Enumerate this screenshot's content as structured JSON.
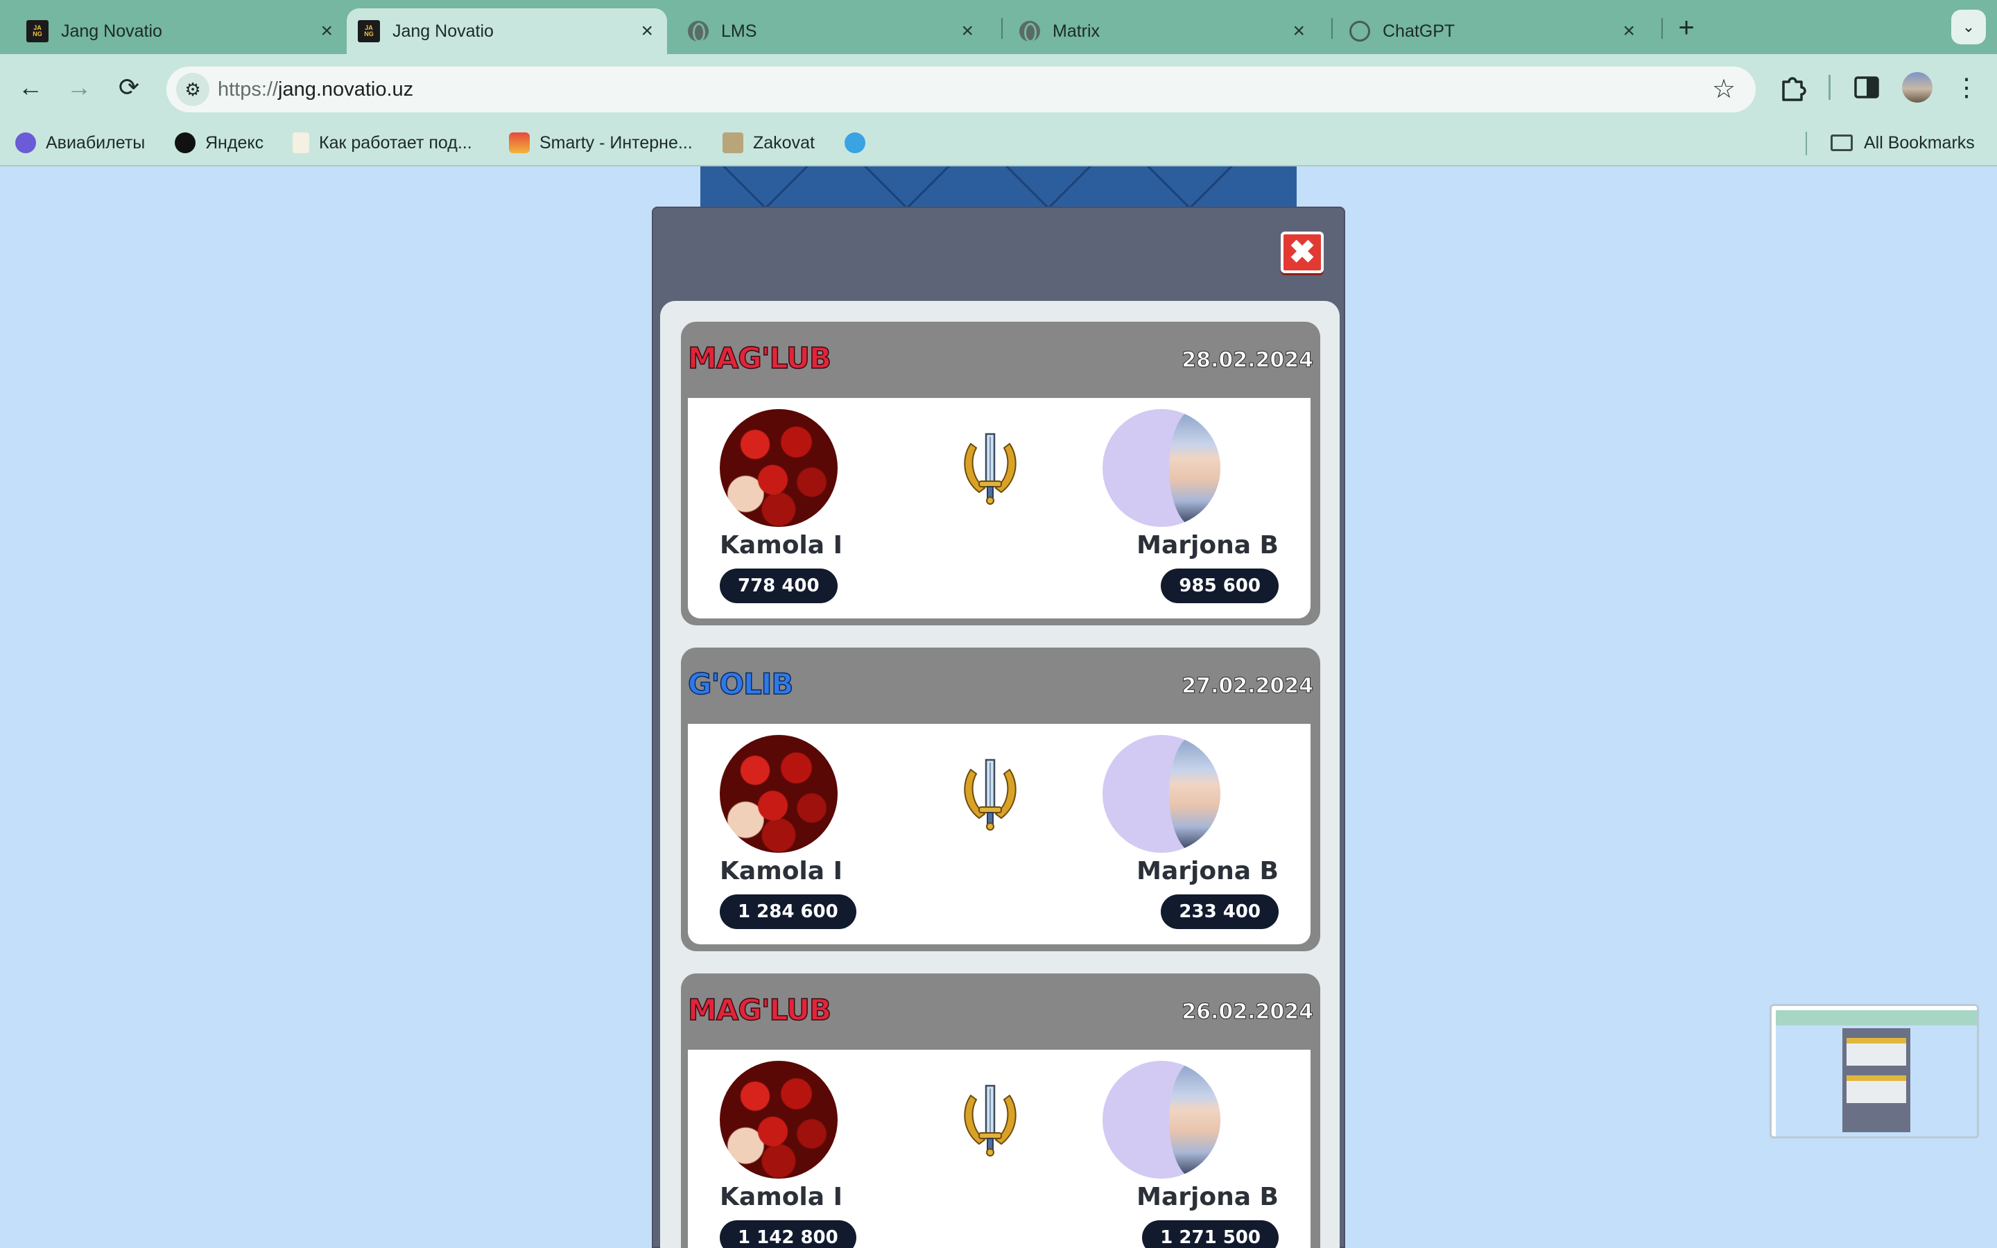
{
  "browser": {
    "tabs": [
      {
        "title": "Jang Novatio",
        "favicon": "jang-novatio-logo",
        "active": false
      },
      {
        "title": "Jang Novatio",
        "favicon": "jang-novatio-logo",
        "active": true
      },
      {
        "title": "LMS",
        "favicon": "globe-icon",
        "active": false
      },
      {
        "title": "Matrix",
        "favicon": "globe-icon",
        "active": false
      },
      {
        "title": "ChatGPT",
        "favicon": "chatgpt-icon",
        "active": false
      }
    ],
    "favicon_text": "JA\nNG",
    "url_scheme": "https://",
    "url_host": "jang.novatio.uz",
    "bookmarks": [
      "Авиабилеты",
      "Яндекс",
      "Как работает под...",
      "Smarty - Интерне...",
      "Zakovat"
    ],
    "all_bookmarks": "All Bookmarks",
    "colors": {
      "tabstrip": "#75b7a0",
      "toolbar": "#c8e6dd"
    }
  },
  "icons": {
    "back": "←",
    "forward": "→",
    "reload": "⟳",
    "star": "☆",
    "new_tab": "+",
    "close_tab": "×",
    "tab_menu": "⌄",
    "menu": "⋮",
    "site_info": "⚙",
    "modal_close": "✖"
  },
  "matches": [
    {
      "result": "MAG'LUB",
      "result_type": "lose",
      "date": "28.02.2024",
      "player1": {
        "name": "Kamola I",
        "score": "778 400"
      },
      "player2": {
        "name": "Marjona B",
        "score": "985 600"
      }
    },
    {
      "result": "G'OLIB",
      "result_type": "win",
      "date": "27.02.2024",
      "player1": {
        "name": "Kamola I",
        "score": "1 284 600"
      },
      "player2": {
        "name": "Marjona B",
        "score": "233 400"
      }
    },
    {
      "result": "MAG'LUB",
      "result_type": "lose",
      "date": "26.02.2024",
      "player1": {
        "name": "Kamola I",
        "score": "1 142 800"
      },
      "player2": {
        "name": "Marjona B",
        "score": "1 271 500"
      }
    }
  ],
  "colors": {
    "page_bg": "#c4dff9",
    "modal_bg": "#5e6478",
    "lose": "#e0253a",
    "win": "#2f78e6",
    "score_pill": "#121a2e",
    "close_btn": "#e23a33"
  }
}
